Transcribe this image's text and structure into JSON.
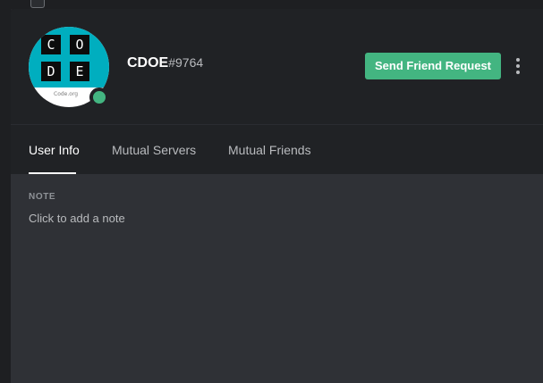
{
  "profile": {
    "avatar_tiles": [
      "C",
      "O",
      "D",
      "E"
    ],
    "avatar_caption": "Code.org",
    "username": "CDOE",
    "discriminator": "#9764",
    "status": "online"
  },
  "actions": {
    "friend_request_label": "Send Friend Request",
    "more_icon": "kebab-menu-icon"
  },
  "tabs": [
    {
      "label": "User Info",
      "active": true
    },
    {
      "label": "Mutual Servers",
      "active": false
    },
    {
      "label": "Mutual Friends",
      "active": false
    }
  ],
  "note": {
    "label": "NOTE",
    "placeholder": "Click to add a note"
  },
  "colors": {
    "accent_green": "#43b581",
    "avatar_teal": "#00aebf",
    "header_bg": "#202225",
    "body_bg": "#2f3136"
  }
}
